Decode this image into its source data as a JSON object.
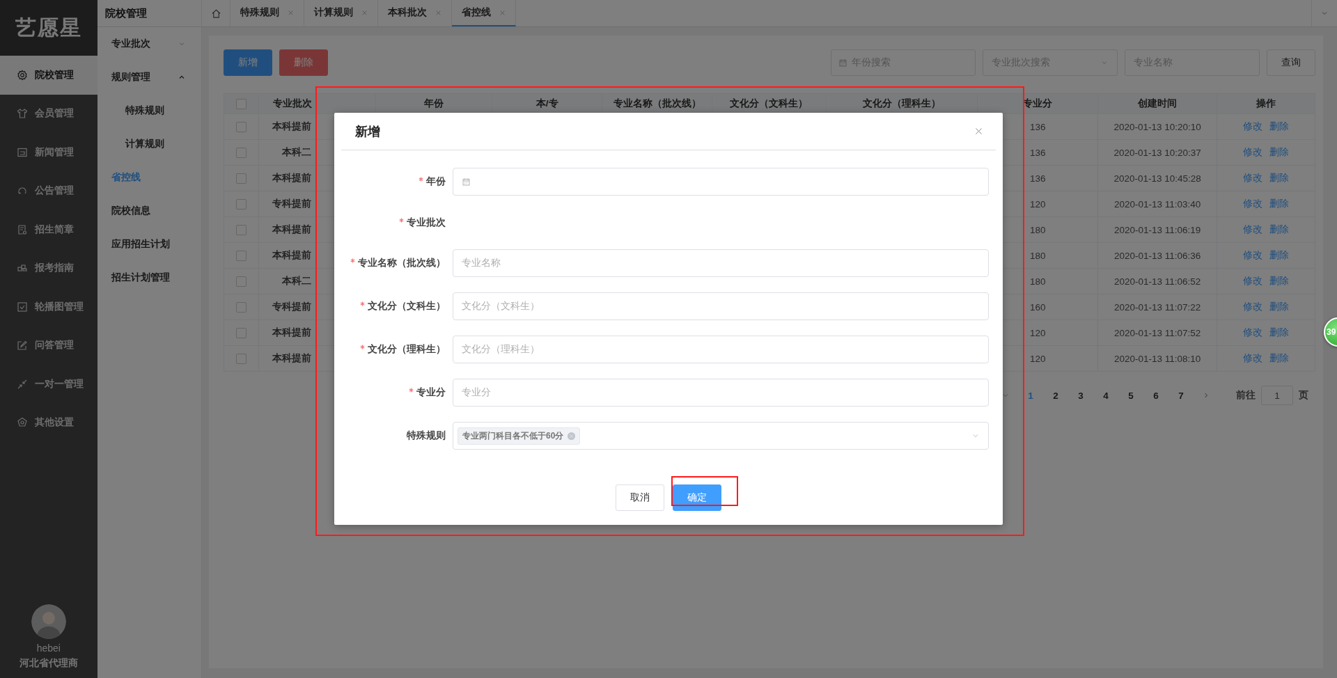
{
  "logo": "艺愿星",
  "nav": [
    {
      "label": "院校管理",
      "kind": "gear",
      "selected": true
    },
    {
      "label": "会员管理",
      "kind": "shirt",
      "selected": false
    },
    {
      "label": "新闻管理",
      "kind": "news",
      "selected": false
    },
    {
      "label": "公告管理",
      "kind": "loop",
      "selected": false
    },
    {
      "label": "招生简章",
      "kind": "doc",
      "selected": false
    },
    {
      "label": "报考指南",
      "kind": "blocks",
      "selected": false
    },
    {
      "label": "轮播图管理",
      "kind": "check",
      "selected": false
    },
    {
      "label": "问答管理",
      "kind": "edit",
      "selected": false
    },
    {
      "label": "一对一管理",
      "kind": "arrows",
      "selected": false
    },
    {
      "label": "其他设置",
      "kind": "badge",
      "selected": false
    }
  ],
  "user": {
    "name": "hebei",
    "role": "河北省代理商"
  },
  "submenu": {
    "title": "院校管理",
    "items": [
      {
        "label": "专业批次",
        "selected": false,
        "expanded": false
      },
      {
        "label": "规则管理",
        "selected": false,
        "expanded": true,
        "children": [
          {
            "label": "特殊规则",
            "selected": false
          },
          {
            "label": "计算规则",
            "selected": false
          }
        ]
      },
      {
        "label": "省控线",
        "selected": true
      },
      {
        "label": "院校信息",
        "selected": false
      },
      {
        "label": "应用招生计划",
        "selected": false
      },
      {
        "label": "招生计划管理",
        "selected": false
      }
    ]
  },
  "tabs": [
    {
      "label": "特殊规则",
      "selected": false
    },
    {
      "label": "计算规则",
      "selected": false
    },
    {
      "label": "本科批次",
      "selected": false
    },
    {
      "label": "省控线",
      "selected": true
    }
  ],
  "toolbar": {
    "buttons": [
      {
        "label": "新增",
        "kind": "primary"
      },
      {
        "label": "删除",
        "kind": "danger"
      }
    ],
    "search": [
      {
        "kind": "date",
        "placeholder": "年份搜索"
      },
      {
        "kind": "select",
        "placeholder": "专业批次搜索"
      },
      {
        "kind": "text",
        "placeholder": "专业名称"
      }
    ],
    "query": "查询"
  },
  "table": {
    "all_checked": false,
    "columns": [
      "专业批次",
      "年份",
      "本/专",
      "专业名称（批次线）",
      "文化分（文科生）",
      "文化分（理科生）",
      "专业分",
      "创建时间",
      "操作"
    ],
    "rows": [
      {
        "checked": false,
        "batch": "本科提前",
        "score": "136",
        "created": "2020-01-13 10:20:10",
        "actions": [
          "修改",
          "删除"
        ]
      },
      {
        "checked": false,
        "batch": "本科二",
        "score": "136",
        "created": "2020-01-13 10:20:37",
        "actions": [
          "修改",
          "删除"
        ]
      },
      {
        "checked": false,
        "batch": "本科提前",
        "score": "136",
        "created": "2020-01-13 10:45:28",
        "actions": [
          "修改",
          "删除"
        ]
      },
      {
        "checked": false,
        "batch": "专科提前",
        "score": "120",
        "created": "2020-01-13 11:03:40",
        "actions": [
          "修改",
          "删除"
        ]
      },
      {
        "checked": false,
        "batch": "本科提前",
        "score": "180",
        "created": "2020-01-13 11:06:19",
        "actions": [
          "修改",
          "删除"
        ]
      },
      {
        "checked": false,
        "batch": "本科提前",
        "score": "180",
        "created": "2020-01-13 11:06:36",
        "actions": [
          "修改",
          "删除"
        ]
      },
      {
        "checked": false,
        "batch": "本科二",
        "score": "180",
        "created": "2020-01-13 11:06:52",
        "actions": [
          "修改",
          "删除"
        ]
      },
      {
        "checked": false,
        "batch": "专科提前",
        "score": "160",
        "created": "2020-01-13 11:07:22",
        "actions": [
          "修改",
          "删除"
        ]
      },
      {
        "checked": false,
        "batch": "本科提前",
        "score": "120",
        "created": "2020-01-13 11:07:52",
        "actions": [
          "修改",
          "删除"
        ]
      },
      {
        "checked": false,
        "batch": "本科提前",
        "score": "120",
        "created": "2020-01-13 11:08:10",
        "actions": [
          "修改",
          "删除"
        ]
      }
    ]
  },
  "pagination": {
    "pages": [
      {
        "label": "1",
        "selected": true
      },
      {
        "label": "2",
        "selected": false
      },
      {
        "label": "3",
        "selected": false
      },
      {
        "label": "4",
        "selected": false
      },
      {
        "label": "5",
        "selected": false
      },
      {
        "label": "6",
        "selected": false
      },
      {
        "label": "7",
        "selected": false
      }
    ],
    "goto_label": "前往",
    "goto_value": "1",
    "page_suffix": "页"
  },
  "dialog": {
    "title": "新增",
    "fields": [
      {
        "label": "年份",
        "required": true,
        "kind": "date"
      },
      {
        "label": "专业批次",
        "required": true,
        "kind": "none"
      },
      {
        "label": "专业名称（批次线）",
        "required": true,
        "kind": "text",
        "placeholder": "专业名称"
      },
      {
        "label": "文化分（文科生）",
        "required": true,
        "kind": "text",
        "placeholder": "文化分（文科生）"
      },
      {
        "label": "文化分（理科生）",
        "required": true,
        "kind": "text",
        "placeholder": "文化分（理科生）"
      },
      {
        "label": "专业分",
        "required": true,
        "kind": "text",
        "placeholder": "专业分"
      },
      {
        "label": "特殊规则",
        "required": false,
        "kind": "multiselect",
        "tags": [
          "专业两门科目各不低于60分"
        ]
      }
    ],
    "buttons": [
      {
        "label": "取消",
        "kind": "default"
      },
      {
        "label": "确定",
        "kind": "primary"
      }
    ]
  },
  "float_badge": "39"
}
